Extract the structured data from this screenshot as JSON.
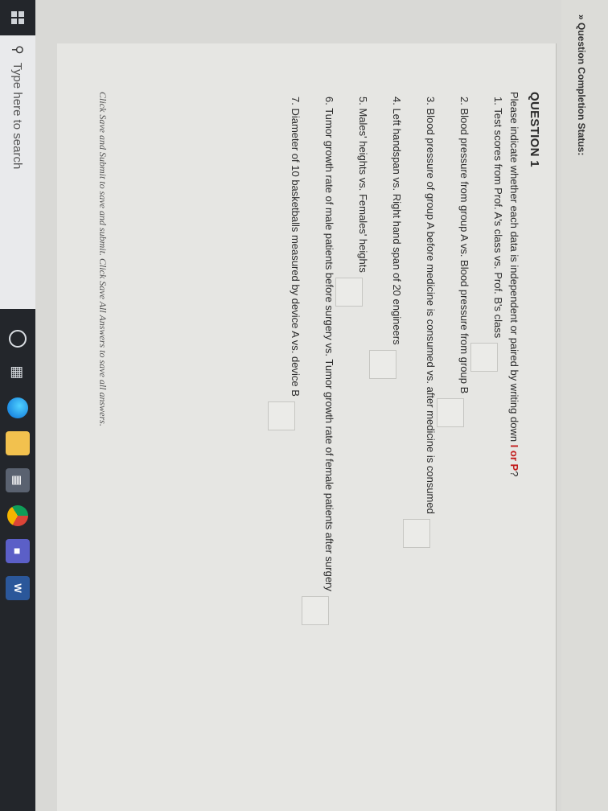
{
  "status": {
    "text": "» Question Completion Status:"
  },
  "question": {
    "title": "QUESTION 1",
    "prompt_lead": "Please indicate whether each data is independent or paired by writing down ",
    "prompt_highlight": "I or P",
    "prompt_tail": "?",
    "items": [
      "1. Test scores from Prof. A's class vs. Prof. B's class",
      "2. Blood pressure from group A vs. Blood pressure from group B",
      "3. Blood pressure of group A before medicine is consumed vs. after medicine is consumed",
      "4. Left handspan vs. Right hand span of 20 engineers",
      "5. Males' heights vs. Females' heights",
      "6. Tumor growth rate of male patients before surgery vs. Tumor growth rate of female patients after surgery",
      "7. Diameter of 10 basketballs measured by device A vs. device B"
    ],
    "answers": [
      "",
      "",
      "",
      "",
      "",
      "",
      ""
    ]
  },
  "footer": {
    "note": "Click Save and Submit to save and submit. Click Save All Answers to save all answers."
  },
  "taskbar": {
    "search_placeholder": "Type here to search",
    "icons": [
      "windows-icon",
      "search-icon",
      "cortana-icon",
      "task-view-icon",
      "edge-icon",
      "file-explorer-icon",
      "store-icon",
      "chrome-icon",
      "teams-icon",
      "word-icon"
    ],
    "word_label": "W"
  }
}
